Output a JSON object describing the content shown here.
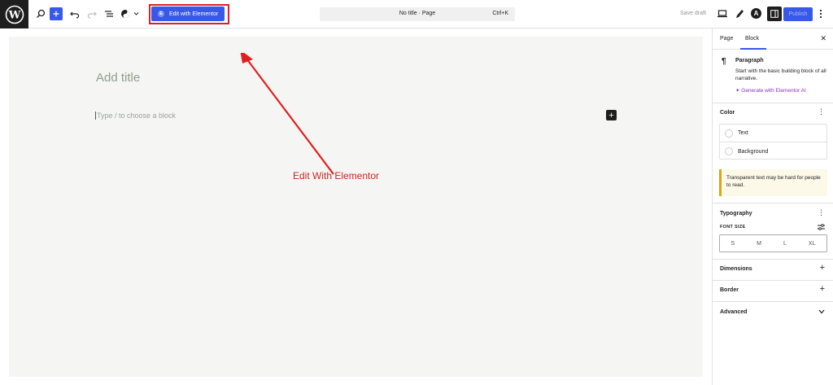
{
  "toolbar": {
    "elementor_label": "Edit with Elementor",
    "doc_title": "No title · Page",
    "shortcut": "Ctrl+K",
    "save_draft": "Save draft",
    "publish": "Publish"
  },
  "canvas": {
    "title_placeholder": "Add title",
    "block_placeholder": "Type / to choose a block"
  },
  "annotation": {
    "text": "Edit With Elementor",
    "color": "#cc2424"
  },
  "sidebar": {
    "tabs": [
      {
        "label": "Page"
      },
      {
        "label": "Block"
      }
    ],
    "block": {
      "name": "Paragraph",
      "description": "Start with the basic building block of all narrative.",
      "ai_link": "Generate with Elementor AI"
    },
    "color": {
      "heading": "Color",
      "items": [
        {
          "label": "Text"
        },
        {
          "label": "Background"
        }
      ],
      "notice": "Transparent text may be hard for people to read."
    },
    "typography": {
      "heading": "Typography",
      "font_size_label": "FONT SIZE",
      "sizes": [
        "S",
        "M",
        "L",
        "XL"
      ]
    },
    "panels": [
      {
        "label": "Dimensions"
      },
      {
        "label": "Border"
      },
      {
        "label": "Advanced"
      }
    ]
  },
  "colors": {
    "accent": "#3858e9",
    "ai_purple": "#8e2ec4",
    "canvas_bg": "#f5f6f3"
  }
}
